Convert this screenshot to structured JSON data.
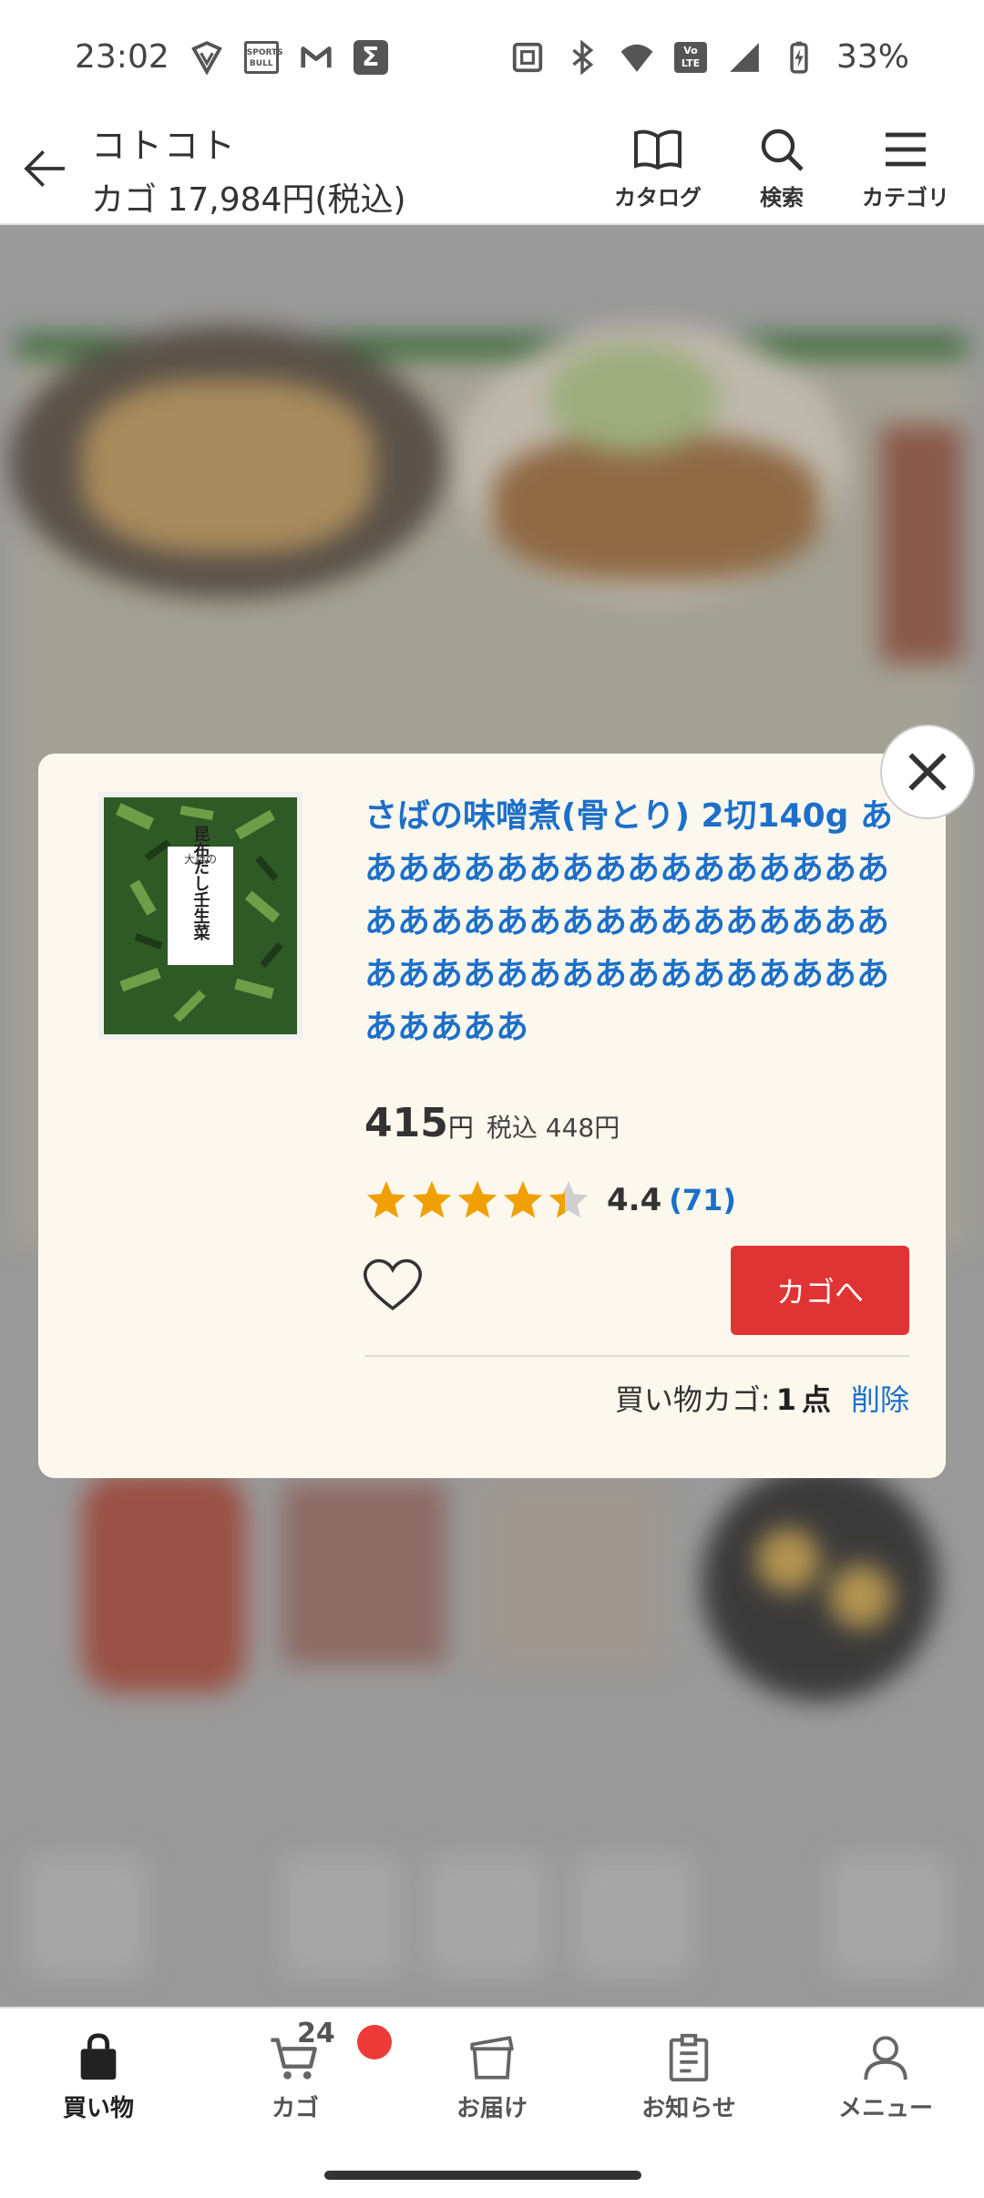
{
  "status_bar": {
    "time": "23:02",
    "left_icons": [
      "vpn-shield-icon",
      "sports-bull-icon",
      "gmail-icon",
      "sigma-app-icon"
    ],
    "sports_bull_text": "SPORTS BULL",
    "volte_text": "Vo LTE",
    "battery": "33%"
  },
  "header": {
    "store_name": "コトコト",
    "cart_total": "カゴ 17,984円(税込)",
    "actions": [
      {
        "label": "カタログ",
        "icon": "book-icon"
      },
      {
        "label": "検索",
        "icon": "search-icon"
      },
      {
        "label": "カテゴリ",
        "icon": "menu-icon"
      }
    ]
  },
  "popup": {
    "product_title": "さばの味噌煮(骨とり) 2切140g ああああああああああああああああああああああああああああああああああああああああああああああああああああああ",
    "price": "415",
    "price_unit": "円",
    "price_tax": "税込 448円",
    "rating": 4.4,
    "rating_text": "4.4",
    "rating_count": "(71)",
    "cart_button": "カゴへ",
    "cart_status_label": "買い物カゴ:",
    "cart_status_count": "1",
    "cart_status_unit": "点",
    "delete_label": "削除",
    "image_label_top": "大森の",
    "image_label_main": "昆布だし壬生菜"
  },
  "bottom_nav": {
    "items": [
      {
        "label": "買い物",
        "icon": "shopping-bag-icon",
        "active": true
      },
      {
        "label": "カゴ",
        "icon": "cart-icon",
        "active": false
      },
      {
        "label": "お届け",
        "icon": "delivery-box-icon",
        "active": false
      },
      {
        "label": "お知らせ",
        "icon": "clipboard-icon",
        "active": false
      },
      {
        "label": "メニュー",
        "icon": "user-icon",
        "active": false
      }
    ],
    "cart_count": "24"
  },
  "colors": {
    "link_blue": "#1d6fc9",
    "cart_red": "#e03434",
    "star_orange": "#f0a000",
    "popup_bg": "#fcf8ed",
    "badge_red": "#ef3a3a"
  }
}
